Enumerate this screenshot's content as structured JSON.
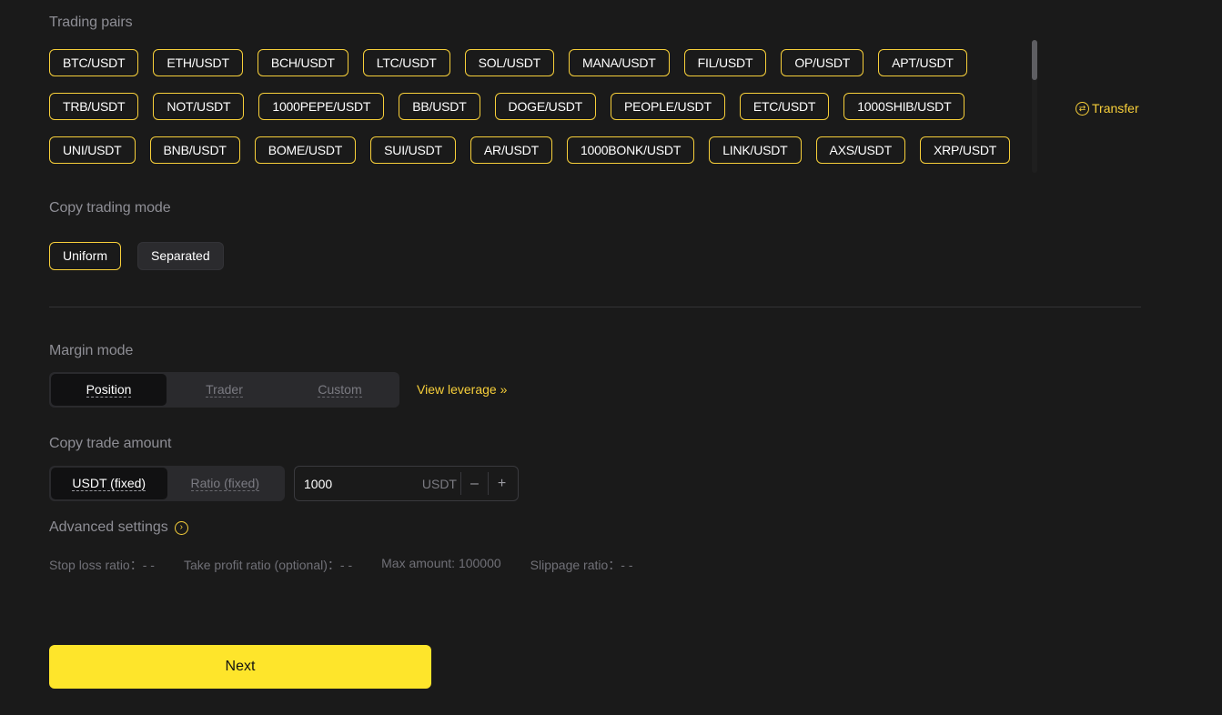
{
  "trading_pairs": {
    "label": "Trading pairs",
    "rows": [
      [
        "BTC/USDT",
        "ETH/USDT",
        "BCH/USDT",
        "LTC/USDT",
        "SOL/USDT",
        "MANA/USDT",
        "FIL/USDT",
        "OP/USDT",
        "APT/USDT"
      ],
      [
        "TRB/USDT",
        "NOT/USDT",
        "1000PEPE/USDT",
        "BB/USDT",
        "DOGE/USDT",
        "PEOPLE/USDT",
        "ETC/USDT",
        "1000SHIB/USDT"
      ],
      [
        "UNI/USDT",
        "BNB/USDT",
        "BOME/USDT",
        "SUI/USDT",
        "AR/USDT",
        "1000BONK/USDT",
        "LINK/USDT",
        "AXS/USDT",
        "XRP/USDT"
      ]
    ],
    "transfer_label": "Transfer",
    "transfer_icon": "swap-circle-icon"
  },
  "copy_trading_mode": {
    "label": "Copy trading mode",
    "options": [
      "Uniform",
      "Separated"
    ],
    "selected": "Uniform"
  },
  "margin_mode": {
    "label": "Margin mode",
    "options": [
      "Position",
      "Trader",
      "Custom"
    ],
    "selected": "Position",
    "view_leverage_label": "View leverage",
    "view_leverage_icon": "double-chevron-right-icon"
  },
  "copy_trade_amount": {
    "label": "Copy trade amount",
    "options": [
      "USDT (fixed)",
      "Ratio (fixed)"
    ],
    "selected": "USDT (fixed)",
    "value": "1000",
    "unit": "USDT",
    "decrement": "–",
    "increment": "+"
  },
  "advanced_settings": {
    "label": "Advanced settings",
    "icon": "chevron-right-circle-icon",
    "params": [
      "Stop loss ratio：- -",
      "Take profit ratio (optional)：- -",
      "Max amount: 100000",
      "Slippage ratio：- -"
    ]
  },
  "next_label": "Next",
  "colors": {
    "background": "#1a1a1a",
    "accent": "#f7cf3a",
    "primary_button": "#fee52b"
  }
}
